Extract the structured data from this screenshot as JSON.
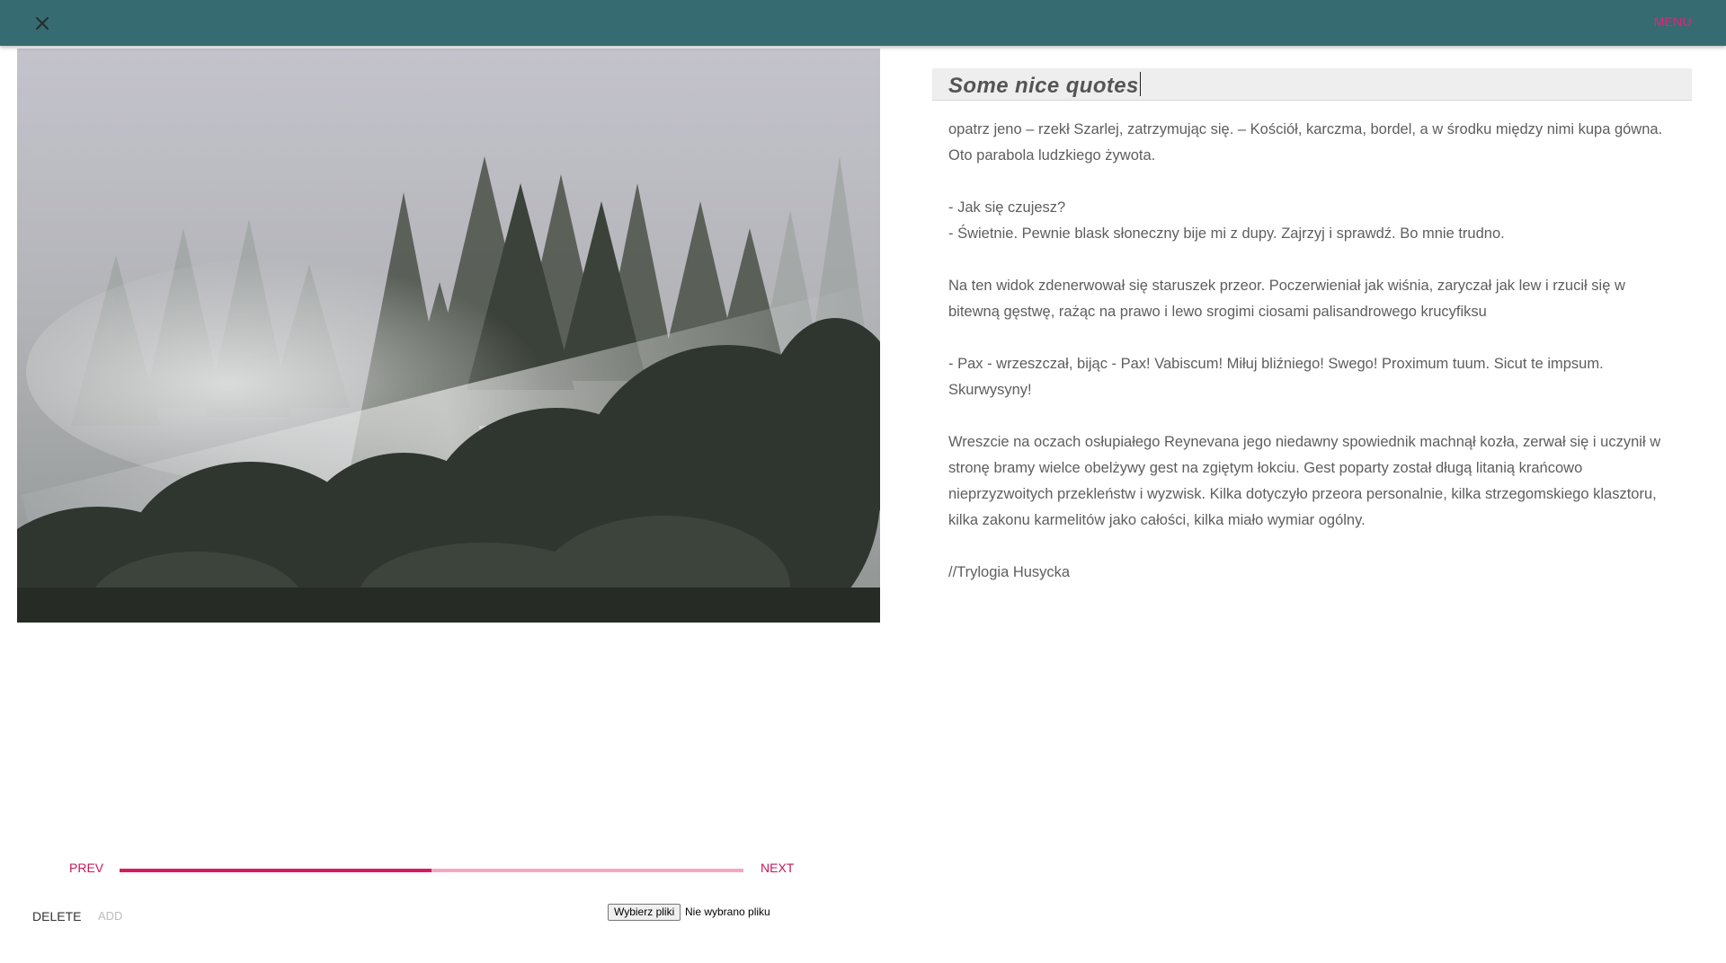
{
  "header": {
    "close_icon": "close-icon",
    "menu_label": "MENU",
    "background_color": "#376b72",
    "accent_color": "#e0267a"
  },
  "photo": {
    "subject": "misty-forest-photo"
  },
  "note": {
    "title": "Some nice quotes",
    "paragraphs": [
      [
        "opatrz jeno – rzekł Szarlej, zatrzymując się. – Kościół, karczma, bordel, a w środku między nimi kupa gówna.",
        "Oto parabola ludzkiego żywota."
      ],
      [
        "- Jak się czujesz?",
        "- Świetnie. Pewnie blask słoneczny bije mi z dupy. Zajrzyj i sprawdź. Bo mnie trudno."
      ],
      [
        "Na ten widok zdenerwował się staruszek przeor. Poczerwieniał jak wiśnia, zaryczał jak lew i rzucił się w",
        "bitewną gęstwę, rażąc na prawo i lewo srogimi ciosami palisandrowego krucyfiksu"
      ],
      [
        "- Pax - wrzeszczał, bijąc - Pax! Vabiscum! Miłuj bliźniego! Swego! Proximum tuum. Sicut te impsum.",
        "Skurwysyny!"
      ],
      [
        "Wreszcie na oczach osłupiałego Reynevana jego niedawny spowiednik machnął kozła, zerwał się i uczynił w",
        "stronę bramy wielce obelżywy gest na zgiętym łokciu. Gest poparty został długą litanią krańcowo",
        "nieprzyzwoitych przekleństw i wyzwisk. Kilka dotyczyło przeora personalnie, kilka strzegomskiego klasztoru,",
        "kilka zakonu karmelitów jako całości, kilka miało wymiar ogólny."
      ],
      [
        "//Trylogia Husycka"
      ]
    ]
  },
  "pager": {
    "prev_label": "PREV",
    "next_label": "NEXT",
    "progress_fraction": 0.5,
    "progress_color": "#d81b60",
    "track_color": "#f2a8c2"
  },
  "actions": {
    "delete_label": "DELETE",
    "add_label": "ADD"
  },
  "file_input": {
    "button_label": "Wybierz pliki",
    "status_text": "Nie wybrano pliku"
  }
}
